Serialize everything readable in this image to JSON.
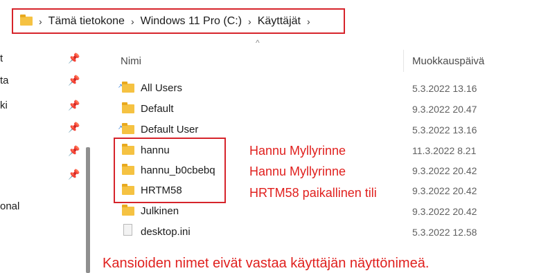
{
  "address_bar": {
    "crumbs": [
      "Tämä tietokone",
      "Windows 11 Pro (C:)",
      "Käyttäjät"
    ],
    "separator": "›"
  },
  "nav_pane": {
    "items": [
      {
        "label": "t"
      },
      {
        "label": "ta"
      },
      {
        "label": "ki"
      },
      {
        "label": ""
      },
      {
        "label": ""
      },
      {
        "label": ""
      },
      {
        "label": "onal"
      }
    ],
    "pin_icon": "pin-icon"
  },
  "columns": {
    "name": "Nimi",
    "modified": "Muokkauspäivä",
    "sort_indicator": "^"
  },
  "files": [
    {
      "name": "All Users",
      "date": "5.3.2022 13.16",
      "type": "folder-shortcut"
    },
    {
      "name": "Default",
      "date": "9.3.2022 20.47",
      "type": "folder"
    },
    {
      "name": "Default User",
      "date": "5.3.2022 13.16",
      "type": "folder-shortcut"
    },
    {
      "name": "hannu",
      "date": "11.3.2022 8.21",
      "type": "folder"
    },
    {
      "name": "hannu_b0cbebq",
      "date": "9.3.2022 20.42",
      "type": "folder"
    },
    {
      "name": "HRTM58",
      "date": "9.3.2022 20.42",
      "type": "folder"
    },
    {
      "name": "Julkinen",
      "date": "9.3.2022 20.42",
      "type": "folder"
    },
    {
      "name": "desktop.ini",
      "date": "5.3.2022 12.58",
      "type": "file"
    }
  ],
  "annotations": {
    "hannu": "Hannu Myllyrinne",
    "hannu_b0cbebq": "Hannu Myllyrinne",
    "hrtm58": "HRTM58 paikallinen tili",
    "bottom_note": "Kansioiden nimet eivät vastaa käyttäjän näyttönimeä."
  },
  "colors": {
    "annotation_red": "#e0201e",
    "folder_yellow": "#f5c242"
  }
}
